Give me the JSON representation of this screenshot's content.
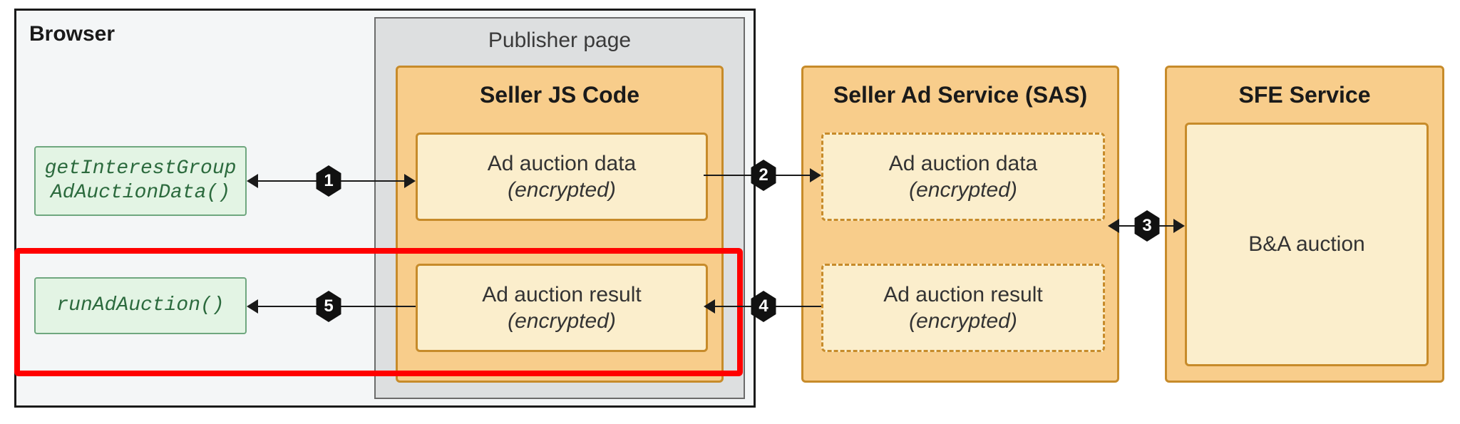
{
  "browser": {
    "title": "Browser"
  },
  "publisher_page": {
    "title": "Publisher page"
  },
  "api": {
    "getInterestGroup": "getInterestGroup\nAdAuctionData()",
    "runAdAuction": "runAdAuction()"
  },
  "seller_js": {
    "title": "Seller JS Code",
    "ad_data": {
      "line1": "Ad auction data",
      "line2": "(encrypted)"
    },
    "ad_result": {
      "line1": "Ad auction result",
      "line2": "(encrypted)"
    }
  },
  "sas": {
    "title": "Seller Ad Service (SAS)",
    "ad_data": {
      "line1": "Ad auction data",
      "line2": "(encrypted)"
    },
    "ad_result": {
      "line1": "Ad auction result",
      "line2": "(encrypted)"
    }
  },
  "sfe": {
    "title": "SFE Service",
    "ba_auction": "B&A auction"
  },
  "steps": {
    "s1": "1",
    "s2": "2",
    "s3": "3",
    "s4": "4",
    "s5": "5"
  }
}
